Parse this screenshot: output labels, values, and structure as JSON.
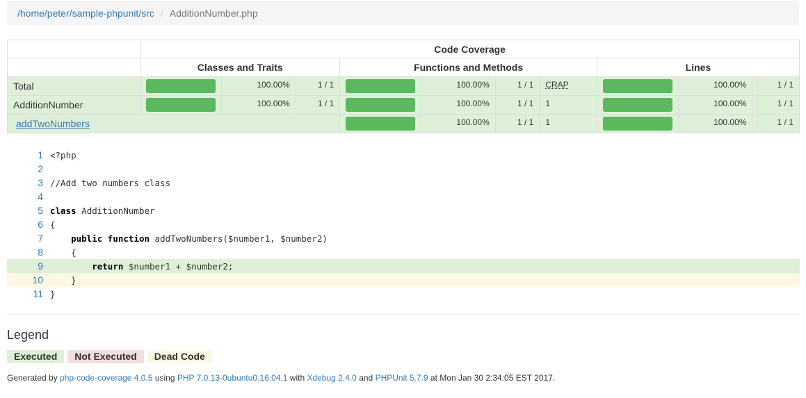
{
  "breadcrumb": {
    "path": "/home/peter/sample-phpunit/src",
    "separator": "/",
    "file": "AdditionNumber.php"
  },
  "coverage_table": {
    "header": "Code Coverage",
    "columns": [
      "Classes and Traits",
      "Functions and Methods",
      "Lines"
    ],
    "rows": [
      {
        "name": "Total",
        "classes_pct": "100.00%",
        "classes_frac": "1 / 1",
        "functions_pct": "100.00%",
        "functions_frac": "1 / 1",
        "crap": "CRAP",
        "lines_pct": "100.00%",
        "lines_frac": "1 / 1",
        "classes_level": 1.0,
        "functions_level": 1.0,
        "lines_level": 1.0
      },
      {
        "name": "AdditionNumber",
        "classes_pct": "100.00%",
        "classes_frac": "1 / 1",
        "functions_pct": "100.00%",
        "functions_frac": "1 / 1",
        "crap": "1",
        "lines_pct": "100.00%",
        "lines_frac": "1 / 1",
        "classes_level": 1.0,
        "functions_level": 1.0,
        "lines_level": 1.0
      },
      {
        "name": "addTwoNumbers",
        "functions_pct": "100.00%",
        "functions_frac": "1 / 1",
        "crap": "1",
        "lines_pct": "100.00%",
        "lines_frac": "1 / 1",
        "functions_level": 1.0,
        "lines_level": 1.0
      }
    ]
  },
  "source": {
    "lines": [
      {
        "n": "1",
        "text": "<?php",
        "status": "none"
      },
      {
        "n": "2",
        "text": "",
        "status": "none"
      },
      {
        "n": "3",
        "text": "//Add two numbers class",
        "status": "none"
      },
      {
        "n": "4",
        "text": "",
        "status": "none"
      },
      {
        "n": "5",
        "text": "class AdditionNumber",
        "status": "none"
      },
      {
        "n": "6",
        "text": "{",
        "status": "none"
      },
      {
        "n": "7",
        "text": "    public function addTwoNumbers($number1, $number2)",
        "status": "none"
      },
      {
        "n": "8",
        "text": "    {",
        "status": "none"
      },
      {
        "n": "9",
        "text": "        return $number1 + $number2;",
        "status": "executed"
      },
      {
        "n": "10",
        "text": "    }",
        "status": "dead"
      },
      {
        "n": "11",
        "text": "}",
        "status": "none"
      }
    ]
  },
  "legend": {
    "title": "Legend",
    "executed": "Executed",
    "not_executed": "Not Executed",
    "dead_code": "Dead Code"
  },
  "footer": {
    "prefix": "Generated by ",
    "tool": "php-code-coverage 4.0.5",
    "using": " using ",
    "php": "PHP 7.0.13-0ubuntu0.16.04.1",
    "with": " with ",
    "xdebug": "Xdebug 2.4.0",
    "and": " and ",
    "phpunit": "PHPUnit 5.7.9",
    "suffix": " at Mon Jan 30 2:34:05 EST 2017."
  },
  "colors": {
    "bar_success": "#5cb85c",
    "row_success": "#dff0d8",
    "dead": "#fcf8e3",
    "not_executed": "#f2dede",
    "link": "#337ab7"
  }
}
